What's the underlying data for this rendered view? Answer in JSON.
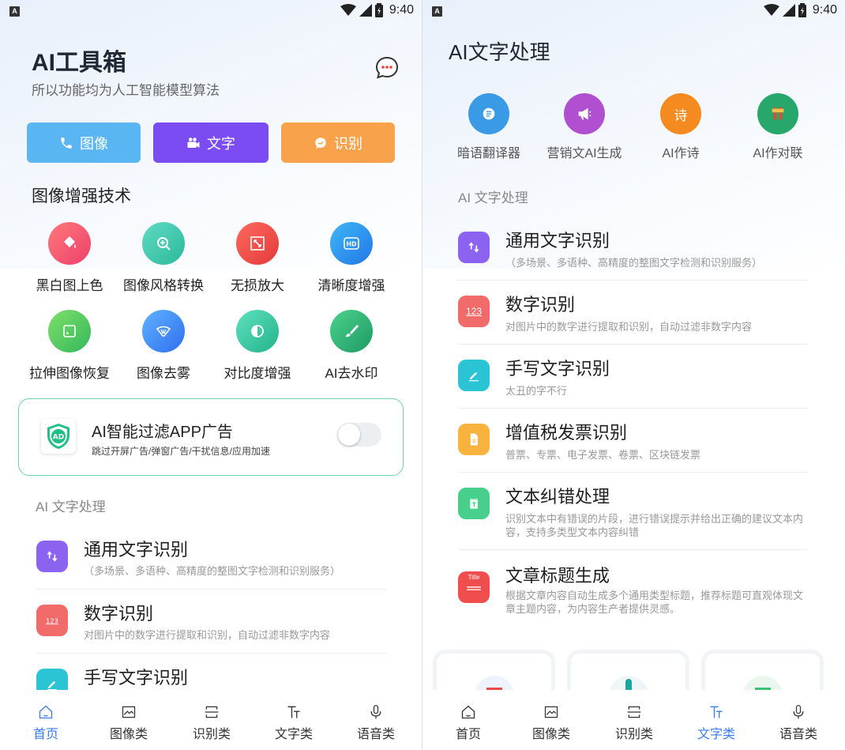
{
  "status": {
    "badge": "A",
    "time": "9:40"
  },
  "home": {
    "title": "AI工具箱",
    "subtitle": "所以功能均为人工智能模型算法",
    "categories": [
      {
        "label": "图像",
        "icon": "phone-icon",
        "color": "#5ab6f3"
      },
      {
        "label": "文字",
        "icon": "video-camera-icon",
        "color": "#7a4cf2"
      },
      {
        "label": "识别",
        "icon": "chat-bubble-icon",
        "color": "#f9a24c"
      }
    ],
    "enhance_title": "图像增强技术",
    "tools": [
      {
        "label": "黑白图上色",
        "icon": "paint-bucket-icon",
        "color": "#f0566e"
      },
      {
        "label": "图像风格转换",
        "icon": "magnify-plus-icon",
        "color": "#3ec9b0"
      },
      {
        "label": "无损放大",
        "icon": "expand-icon",
        "color": "#ee4a4a"
      },
      {
        "label": "清晰度增强",
        "icon": "hd-icon",
        "color": "#2f8df0"
      },
      {
        "label": "拉伸图像恢复",
        "icon": "frame-icon",
        "color": "#47c76a"
      },
      {
        "label": "图像去雾",
        "icon": "fog-icon",
        "color": "#3f8cf5"
      },
      {
        "label": "对比度增强",
        "icon": "contrast-icon",
        "color": "#37c9a4"
      },
      {
        "label": "AI去水印",
        "icon": "brush-icon",
        "color": "#2bb67a"
      }
    ],
    "ad": {
      "title": "AI智能过滤APP广告",
      "desc": "跳过开屏广告/弹窗广告/干扰信息/应用加速",
      "badge": "AD",
      "enabled": false
    },
    "text_section": "AI 文字处理",
    "list": [
      {
        "title": "通用文字识别",
        "desc": "（多场景、多语种、高精度的整图文字检测和识别服务）"
      },
      {
        "title": "数字识别",
        "desc": "对图片中的数字进行提取和识别，自动过滤非数字内容"
      },
      {
        "title": "手写文字识别",
        "desc": ""
      }
    ]
  },
  "text_page": {
    "title": "AI文字处理",
    "features": [
      {
        "label": "暗语翻译器",
        "icon": "translate-icon",
        "color": "#3a9ae6"
      },
      {
        "label": "营销文AI生成",
        "icon": "megaphone-icon",
        "color": "#b04fd0"
      },
      {
        "label": "AI作诗",
        "icon": "poem-icon",
        "color": "#f58a1f",
        "glyph": "诗"
      },
      {
        "label": "AI作对联",
        "icon": "couplet-icon",
        "color": "#27a76b"
      }
    ],
    "section": "AI 文字处理",
    "list": [
      {
        "title": "通用文字识别",
        "desc": "（多场景、多语种、高精度的整图文字检测和识别服务）",
        "icon": "sort-icon",
        "color": "#8c62f0"
      },
      {
        "title": "数字识别",
        "desc": "对图片中的数字进行提取和识别，自动过滤非数字内容",
        "icon": "numbers-icon",
        "color": "#f16b6b",
        "glyph": "123"
      },
      {
        "title": "手写文字识别",
        "desc": "太丑的字不行",
        "icon": "pen-icon",
        "color": "#2bc4d4"
      },
      {
        "title": "增值税发票识别",
        "desc": "普票、专票、电子发票、卷票、区块链发票",
        "icon": "invoice-icon",
        "color": "#f8b33f"
      },
      {
        "title": "文本纠错处理",
        "desc": "识别文本中有错误的片段，进行错误提示并给出正确的建议文本内容，支持多类型文本内容纠错",
        "icon": "document-check-icon",
        "color": "#48cf8c"
      },
      {
        "title": "文章标题生成",
        "desc": "根据文章内容自动生成多个通用类型标题，推荐标题可直观体现文章主题内容，为内容生产者提供灵感。",
        "icon": "title-icon",
        "color": "#f04e4e",
        "glyph": "Title"
      }
    ]
  },
  "tabs": [
    {
      "label": "首页",
      "icon": "home-icon"
    },
    {
      "label": "图像类",
      "icon": "image-icon"
    },
    {
      "label": "识别类",
      "icon": "scan-icon"
    },
    {
      "label": "文字类",
      "icon": "text-icon"
    },
    {
      "label": "语音类",
      "icon": "microphone-icon"
    }
  ],
  "active_tab_left": "首页",
  "active_tab_right": "文字类",
  "accent": "#3b7bf0"
}
